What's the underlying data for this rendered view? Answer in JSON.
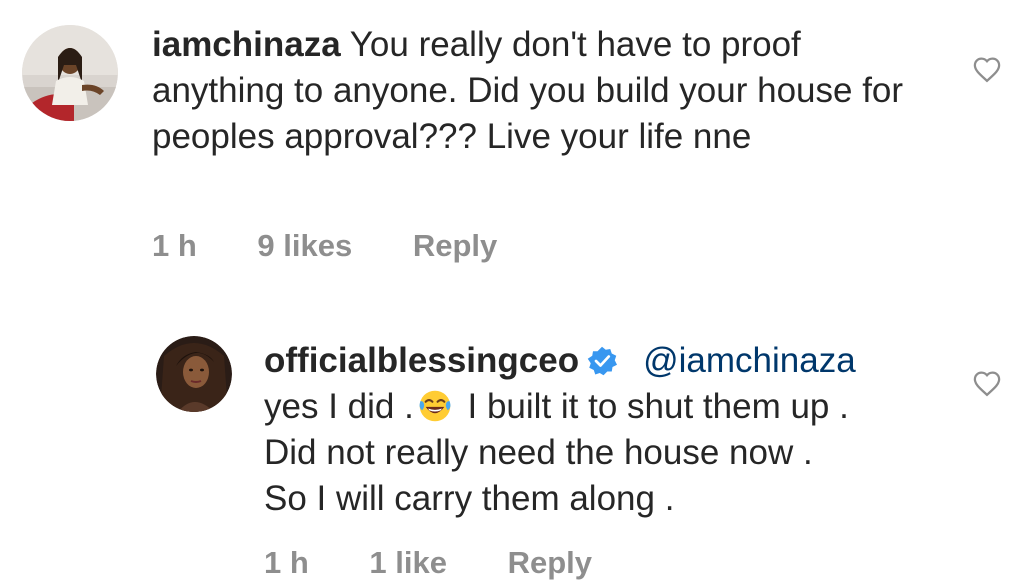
{
  "comments": [
    {
      "username": "iamchinaza",
      "text": "You really don't have to proof anything to anyone. Did you build your house for peoples approval??? Live your life nne",
      "time": "1 h",
      "likes": "9 likes",
      "reply_label": "Reply",
      "icons": {
        "like": "heart-outline-icon"
      }
    },
    {
      "username": "officialblessingceo",
      "mention": "@iamchinaza",
      "text_before_emoji": "yes I did .",
      "emoji": "face-with-tears-of-joy",
      "text_after_emoji": " I built it to shut them up .",
      "line2": "Did not really need the house now .",
      "line3": "So I will carry them along .",
      "time": "1 h",
      "likes": "1 like",
      "reply_label": "Reply",
      "icons": {
        "verified": "verified-badge-icon",
        "like": "heart-outline-icon"
      }
    }
  ],
  "colors": {
    "text": "#262626",
    "meta": "#8e8e8e",
    "mention": "#00376b",
    "verified": "#3897f0"
  }
}
